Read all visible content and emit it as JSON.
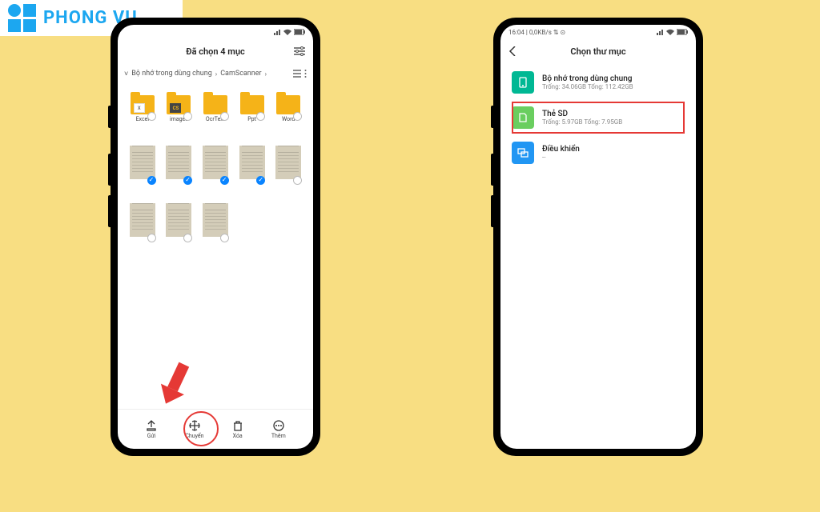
{
  "logo": {
    "text": "PHONG VU"
  },
  "phone1": {
    "status": {
      "left": "",
      "signal_icons": true
    },
    "title": "Đã chọn 4 mục",
    "breadcrumb": {
      "path1": "Bộ nhớ trong dùng chung",
      "path2": "CamScanner"
    },
    "folders": [
      {
        "label": "Excel",
        "overlay": "X",
        "selected": false
      },
      {
        "label": "images",
        "overlay": "CS",
        "overlay_style": "cs",
        "selected": false
      },
      {
        "label": "OcrText",
        "overlay": "",
        "selected": false
      },
      {
        "label": "Ppt",
        "overlay": "",
        "selected": false
      },
      {
        "label": "Word",
        "overlay": "",
        "selected": false
      }
    ],
    "docs_row1": [
      {
        "selected": true
      },
      {
        "selected": true
      },
      {
        "selected": true
      },
      {
        "selected": true
      },
      {
        "selected": false
      }
    ],
    "docs_row2": [
      {
        "selected": false
      },
      {
        "selected": false
      },
      {
        "selected": false
      }
    ],
    "bottom": [
      {
        "id": "send",
        "label": "Gửi"
      },
      {
        "id": "move",
        "label": "Chuyển"
      },
      {
        "id": "delete",
        "label": "Xóa"
      },
      {
        "id": "more",
        "label": "Thêm"
      }
    ]
  },
  "phone2": {
    "status": {
      "left": "16:04 | 0,0KB/s ⇅ ⊙"
    },
    "title": "Chọn thư mục",
    "items": [
      {
        "icon": "a",
        "name": "Bộ nhớ trong dùng chung",
        "sub": "Trống: 34.06GB Tổng: 112.42GB",
        "highlight": false
      },
      {
        "icon": "b",
        "name": "Thẻ SD",
        "sub": "Trống: 5.97GB Tổng: 7.95GB",
        "highlight": true
      },
      {
        "icon": "c",
        "name": "Điều khiển",
        "sub": "--",
        "highlight": false
      }
    ]
  }
}
